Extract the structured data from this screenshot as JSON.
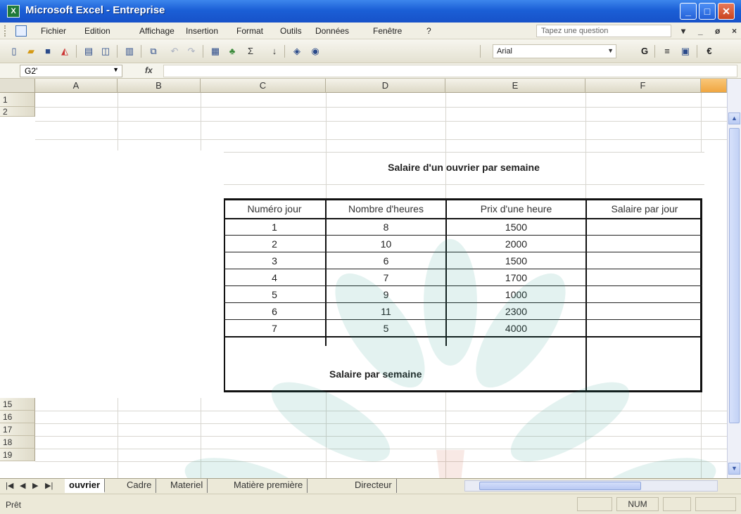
{
  "window": {
    "title": "Microsoft Excel - Entreprise",
    "app_icon": "excel-icon",
    "controls": {
      "min": "_",
      "max": "□",
      "close": "✕"
    }
  },
  "menubar": {
    "items": [
      "Fichier",
      "Edition",
      "Affichage",
      "Insertion",
      "Format",
      "Outils",
      "Données",
      "Fenêtre",
      "?"
    ],
    "help_placeholder": "Tapez une question",
    "right_controls": [
      "▾",
      "_",
      "ø",
      "×"
    ]
  },
  "toolbar": {
    "font": "Arial",
    "icons": [
      "new-icon",
      "open-icon",
      "save-icon",
      "permission-icon",
      "print-icon",
      "print-preview-icon",
      "research-icon",
      "copy-icon",
      "undo-icon",
      "redo-icon",
      "hyperlink-icon",
      "chart-icon",
      "sum-icon",
      "sort-icon",
      "drawing-icon",
      "help-icon",
      "bold-icon",
      "center-icon",
      "merge-icon",
      "euro-icon"
    ]
  },
  "formulabar": {
    "cell_ref": "G2'",
    "fx": "fx",
    "value": ""
  },
  "columns": [
    "A",
    "B",
    "C",
    "D",
    "E",
    "F"
  ],
  "rows_visible_top": [
    "1",
    "2"
  ],
  "rows_visible_bottom": [
    "15",
    "16",
    "17",
    "18",
    "19"
  ],
  "sheet": {
    "title": "Salaire d'un ouvrier par semaine",
    "headers": [
      "Numéro jour",
      "Nombre d'heures",
      "Prix d'une heure",
      "Salaire par jour"
    ],
    "rows": [
      [
        "1",
        "8",
        "1500",
        ""
      ],
      [
        "2",
        "10",
        "2000",
        ""
      ],
      [
        "3",
        "6",
        "1500",
        ""
      ],
      [
        "4",
        "7",
        "1700",
        ""
      ],
      [
        "5",
        "9",
        "1000",
        ""
      ],
      [
        "6",
        "11",
        "2300",
        ""
      ],
      [
        "7",
        "5",
        "4000",
        ""
      ]
    ],
    "total_label": "Salaire par semaine"
  },
  "tabs": {
    "nav": [
      "|◀",
      "◀",
      "▶",
      "▶|"
    ],
    "items": [
      "ouvrier",
      "Cadre",
      "Materiel",
      "Matière première",
      "Directeur"
    ],
    "active": "ouvrier"
  },
  "status": {
    "text": "Prêt",
    "num": "NUM"
  }
}
